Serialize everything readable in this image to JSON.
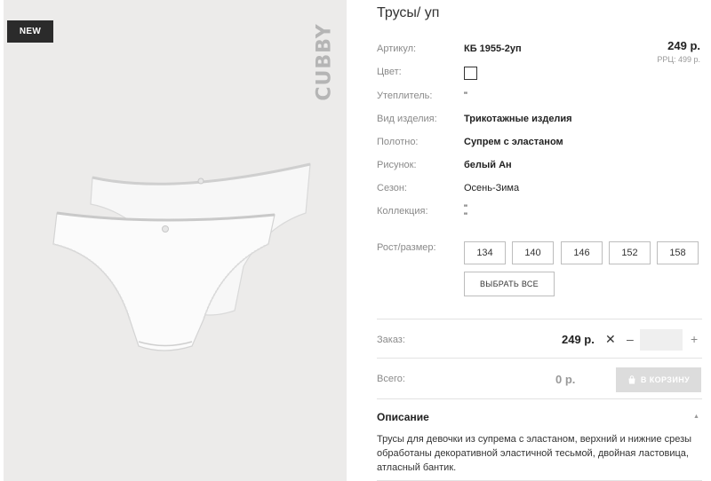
{
  "badge": {
    "new": "NEW"
  },
  "brand": "CUBBY",
  "product": {
    "title": "Трусы/ уп"
  },
  "attributes": [
    {
      "label": "Артикул:",
      "value": "КБ 1955-2уп"
    },
    {
      "label": "Цвет:",
      "value": ""
    },
    {
      "label": "Утеплитель:",
      "value": "\""
    },
    {
      "label": "Вид изделия:",
      "value": "Трикотажные изделия"
    },
    {
      "label": "Полотно:",
      "value": "Супрем с эластаном"
    },
    {
      "label": "Рисунок:",
      "value": "белый Ан"
    },
    {
      "label": "Сезон:",
      "value": "Осень-Зима"
    },
    {
      "label": "Коллекция:",
      "value": "\"\n\""
    }
  ],
  "price": {
    "main": "249 р.",
    "rrp": "РРЦ: 499 р."
  },
  "sizes": {
    "label": "Рост/размер:",
    "options": [
      "134",
      "140",
      "146",
      "152",
      "158"
    ],
    "select_all": "ВЫБРАТЬ ВСЕ"
  },
  "order": {
    "label": "Заказ:",
    "price": "249 р.",
    "quantity": ""
  },
  "total": {
    "label": "Всего:",
    "value": "0 р.",
    "cart_button": "В КОРЗИНУ"
  },
  "description": {
    "heading": "Описание",
    "text": "Трусы для девочки из супрема с эластаном, верхний и нижние срезы обработаны декоративной эластичной тесьмой, двойная ластовица, атласный бантик."
  },
  "colors": {
    "badge_bg": "#2b2b2b",
    "image_bg": "#ecebea",
    "cart_bg": "#dcdcdc",
    "qty_bg": "#efefef"
  }
}
